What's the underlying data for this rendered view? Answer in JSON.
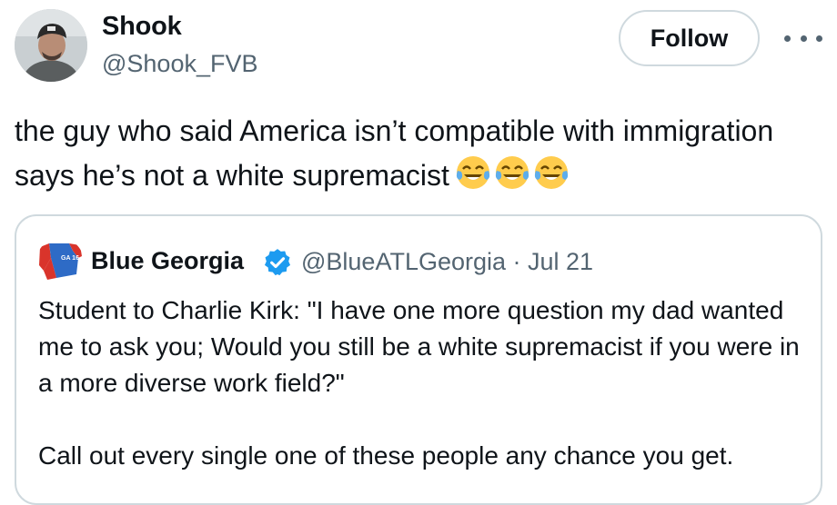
{
  "author": {
    "display_name": "Shook",
    "handle": "@Shook_FVB"
  },
  "actions": {
    "follow_label": "Follow",
    "more_icon": "more-horizontal-icon"
  },
  "tweet": {
    "text": "the guy who said America isn’t compatible with immigration says he’s not a white supremacist",
    "emojis": [
      "😂",
      "😂",
      "😂"
    ]
  },
  "quoted_tweet": {
    "display_name": "Blue Georgia",
    "handle_date": "@BlueATLGeorgia · Jul 21",
    "verified": true,
    "avatar_text": "GA 16",
    "paragraph1": "Student to Charlie Kirk: \"I have one more question my dad wanted me to ask you; Would you still be a white supremacist if you were in a more diverse work field?\"",
    "paragraph2": "Call out every single one of these people any chance you get."
  },
  "colors": {
    "text": "#0f1419",
    "secondary": "#536471",
    "border": "#cfd9de",
    "verified": "#1d9bf0"
  }
}
